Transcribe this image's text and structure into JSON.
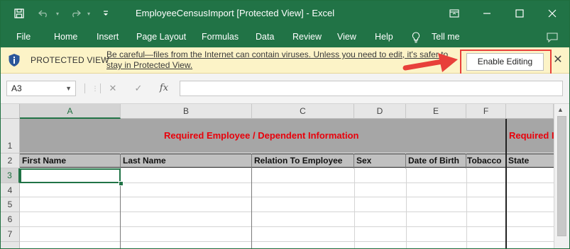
{
  "window": {
    "title": "EmployeeCensusImport  [Protected View]  -  Excel",
    "qat": {
      "save_icon": "save-icon",
      "undo_icon": "undo-icon",
      "redo_icon": "redo-icon",
      "customize_icon": "customize-qat-icon"
    },
    "controls": {
      "ribbon_display": "ribbon-display-icon",
      "minimize": "minimize-icon",
      "maximize": "maximize-icon",
      "close": "close-icon"
    }
  },
  "ribbon_tabs": [
    "File",
    "Home",
    "Insert",
    "Page Layout",
    "Formulas",
    "Data",
    "Review",
    "View",
    "Help"
  ],
  "tell_me": "Tell me",
  "protected_view": {
    "label": "PROTECTED VIEW",
    "message_line1": "Be careful—files from the Internet can contain viruses. Unless you need to edit, it's safer to",
    "message_line2": "stay in Protected View.",
    "button": "Enable Editing",
    "highlight_color": "#e8403a"
  },
  "formula_bar": {
    "name_box": "A3",
    "fx": "fx",
    "value": ""
  },
  "grid": {
    "columns": [
      "A",
      "B",
      "C",
      "D",
      "E",
      "F"
    ],
    "rows": [
      "1",
      "2",
      "3",
      "4",
      "5",
      "6",
      "7"
    ],
    "active_column": "A",
    "active_row": "3",
    "band_left": "Required Employee / Dependent Information",
    "band_right": "Required I",
    "headers": [
      "First Name",
      "Last Name",
      "Relation To Employee",
      "Sex",
      "Date of Birth",
      "Tobacco",
      "State"
    ]
  },
  "colors": {
    "excel_green": "#217346",
    "band_gray": "#a6a6a6",
    "header_red": "#e8000b",
    "protected_bar": "#fcf3c7"
  }
}
